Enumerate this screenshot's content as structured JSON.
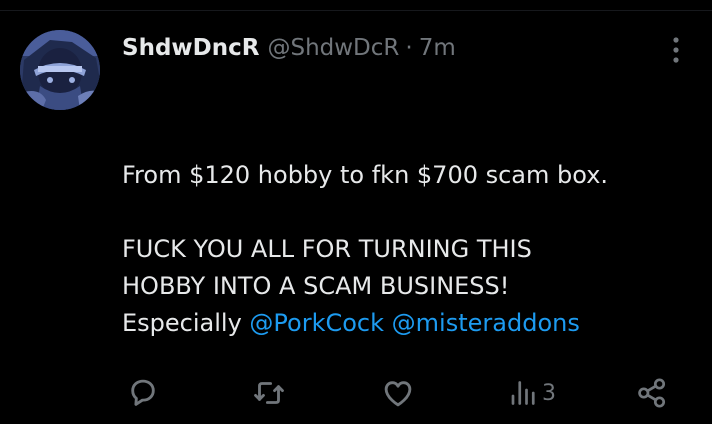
{
  "tweet": {
    "display_name": "ShdwDncR",
    "handle": "@ShdwDcR",
    "separator": "·",
    "time": "7m",
    "line1": "From $120 hobby to fkn $700 scam box.",
    "line2": "FUCK YOU ALL FOR TURNING THIS",
    "line3": "HOBBY INTO A SCAM BUSINESS!",
    "line4_prefix": "Especially",
    "mention1": "@PorkCock",
    "mention2": "@misteraddons"
  },
  "actions": {
    "reply_icon": "speech-bubble-icon",
    "retweet_icon": "retweet-arrows-icon",
    "like_icon": "heart-icon",
    "views_icon": "bar-chart-icon",
    "views_count": "3",
    "share_icon": "share-nodes-icon",
    "more_icon": "vertical-ellipsis-icon"
  },
  "colors": {
    "background": "#000000",
    "text": "#e7e9ea",
    "muted": "#71767b",
    "link": "#1d9bf0"
  }
}
